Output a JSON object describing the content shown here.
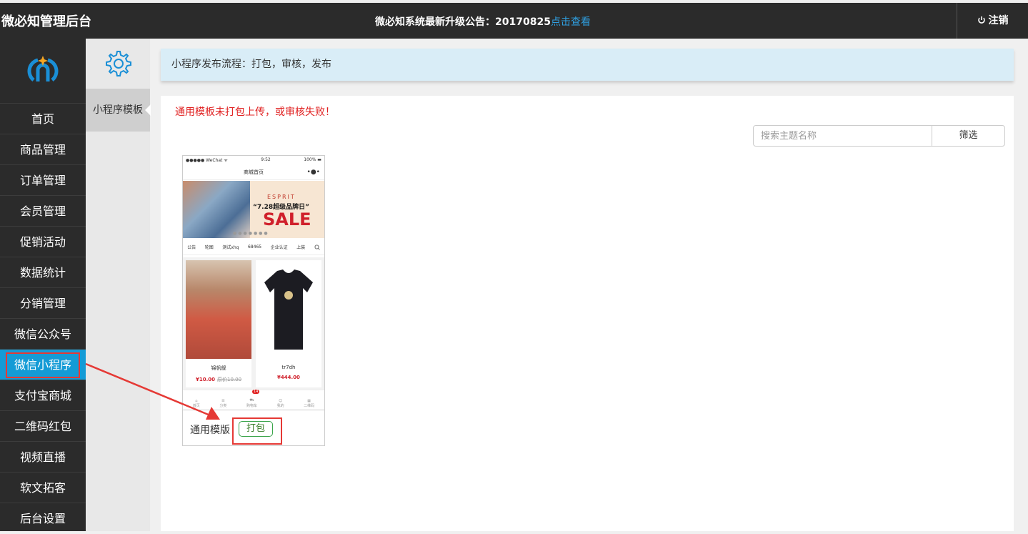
{
  "header": {
    "brand": "微必知管理后台",
    "notice": "微必知系统最新升级公告：20170825",
    "notice_link": "点击查看",
    "logout_label": "注销"
  },
  "sidebar": {
    "items": [
      {
        "label": "首页"
      },
      {
        "label": "商品管理"
      },
      {
        "label": "订单管理"
      },
      {
        "label": "会员管理"
      },
      {
        "label": "促销活动"
      },
      {
        "label": "数据统计"
      },
      {
        "label": "分销管理"
      },
      {
        "label": "微信公众号"
      },
      {
        "label": "微信小程序"
      },
      {
        "label": "支付宝商城"
      },
      {
        "label": "二维码红包"
      },
      {
        "label": "视频直播"
      },
      {
        "label": "软文拓客"
      },
      {
        "label": "后台设置"
      }
    ],
    "active_index": 8
  },
  "subnav": {
    "item": "小程序模板"
  },
  "banner": {
    "text": "小程序发布流程：打包，审核，发布"
  },
  "panel": {
    "error": "通用模板未打包上传，或审核失败！",
    "search_placeholder": "搜索主题名称",
    "filter_label": "筛选"
  },
  "card": {
    "template_name": "通用模版",
    "pack_label": "打包",
    "phone": {
      "carrier": "●●●●● WeChat ᯤ",
      "time": "9:52",
      "battery": "100% ▬",
      "title": "商城首页",
      "hero_brand": "ESPRIT",
      "hero_tag": "“7.28超级品牌日”",
      "hero_sale": "SALE",
      "tabs": [
        "公告",
        "轮图",
        "测试xhq",
        "68465",
        "企业认证",
        "上装"
      ],
      "products": [
        {
          "name": "锦帆舰",
          "price": "¥10.00",
          "old_price": "原价10.00"
        },
        {
          "name": "tr7dh",
          "price": "¥444.00",
          "old_price": ""
        }
      ],
      "tabbar": [
        "首页",
        "分类",
        "购物车",
        "我的",
        "二维码"
      ],
      "cart_badge": "14"
    }
  },
  "colors": {
    "topbar": "#2b2b2b",
    "active": "#149bd6",
    "error": "#e02020",
    "highlight": "#e53935"
  }
}
